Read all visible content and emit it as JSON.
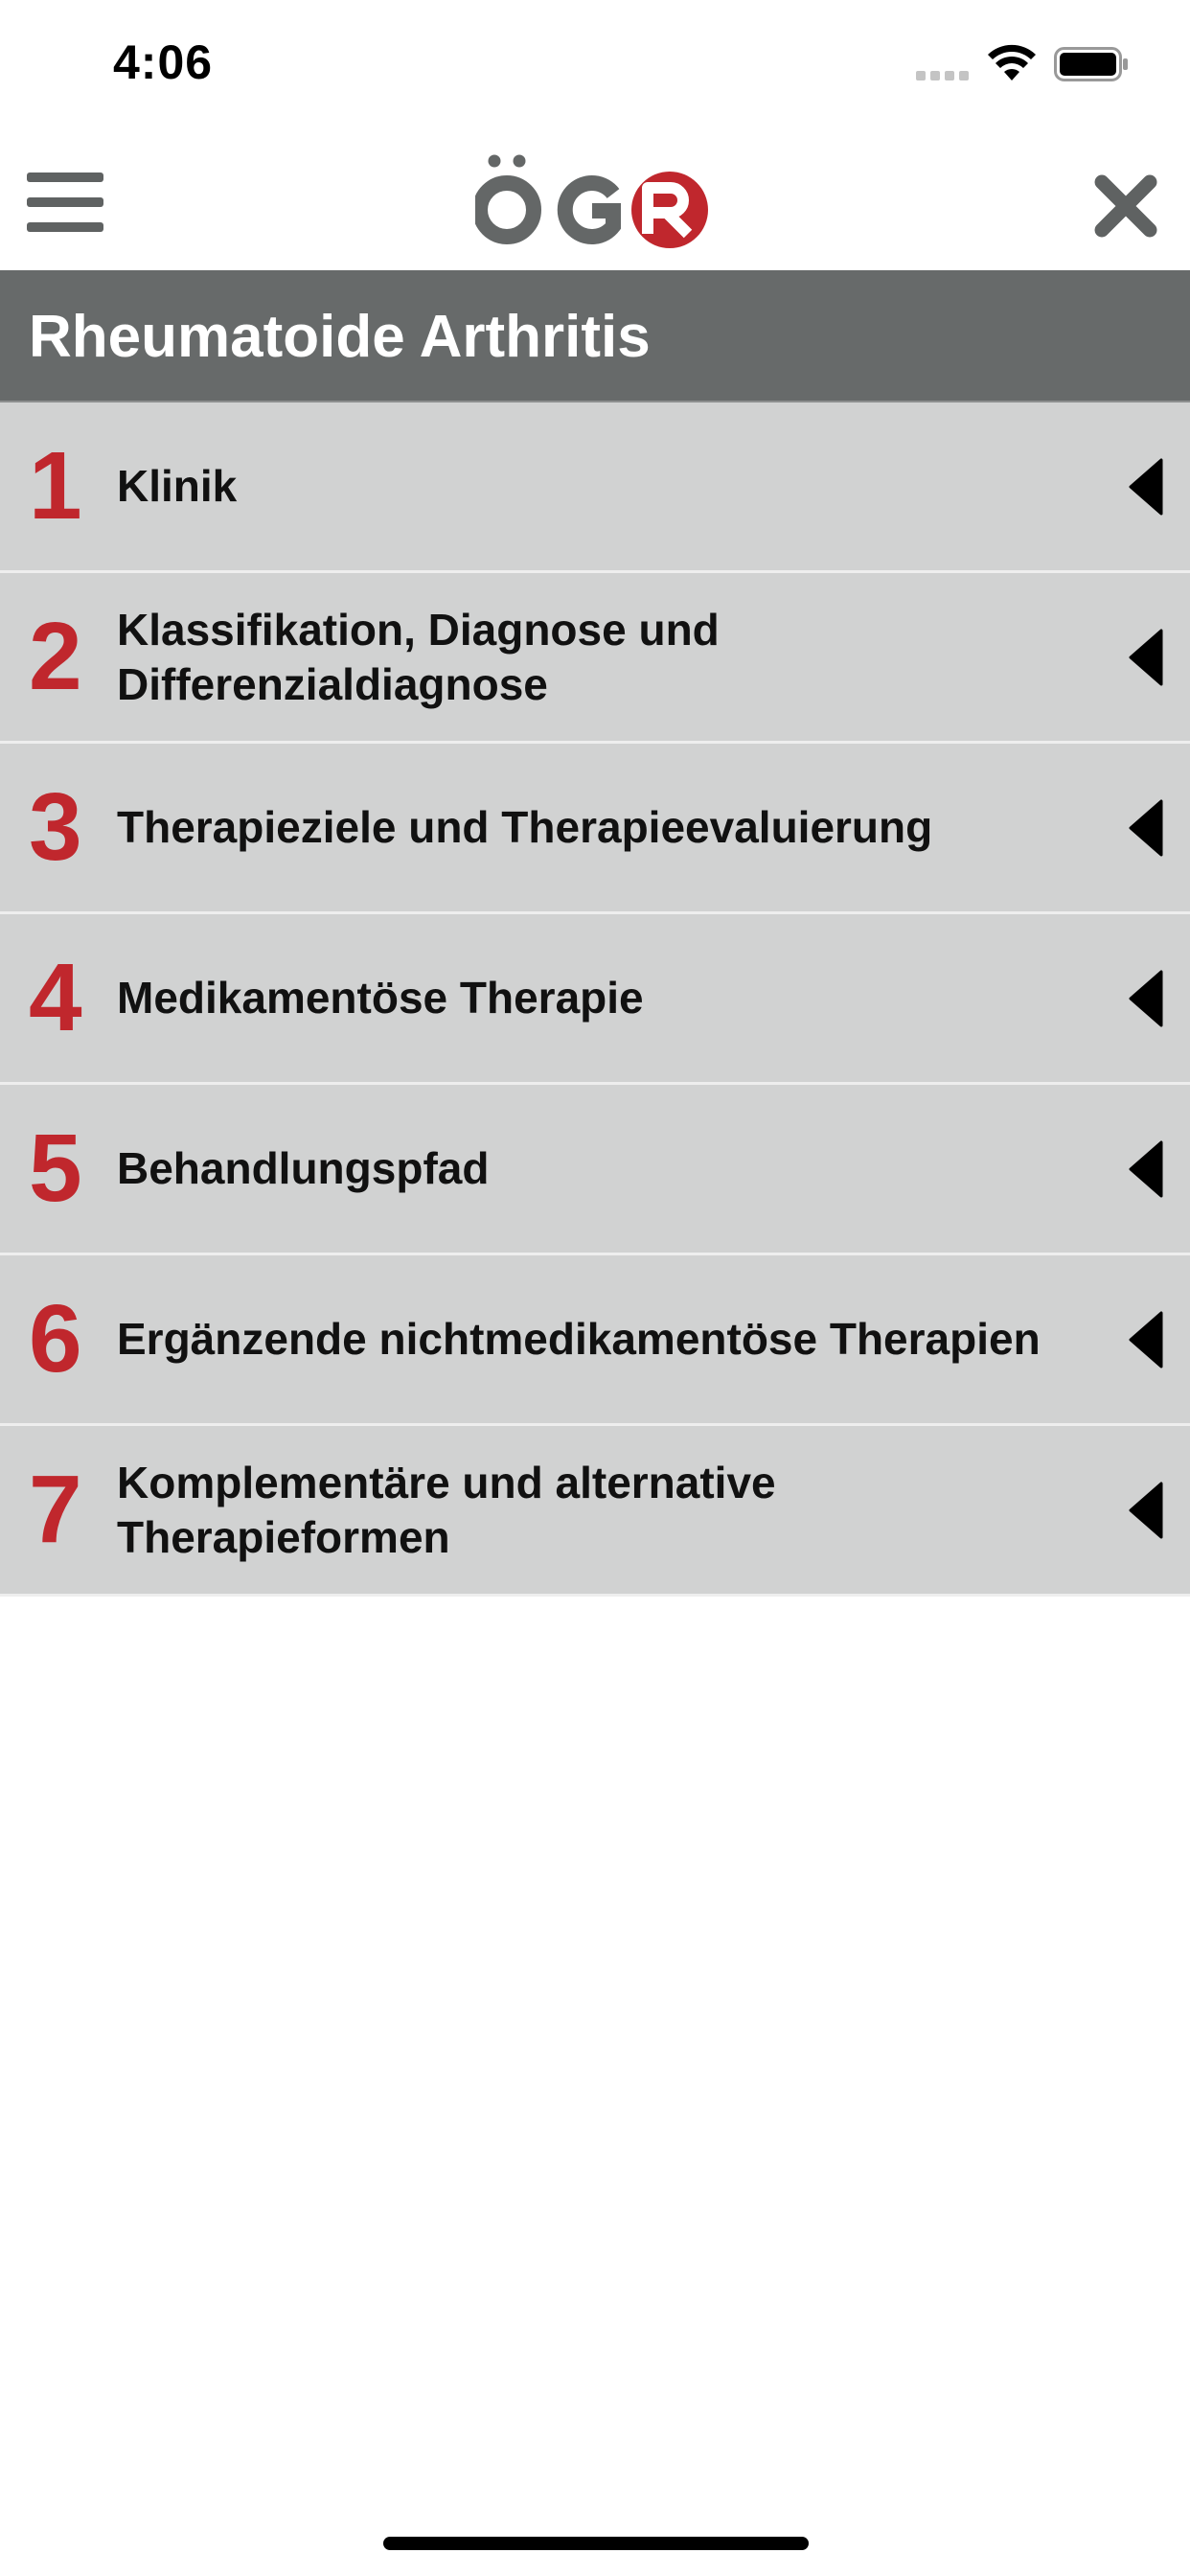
{
  "status_bar": {
    "time": "4:06"
  },
  "header": {
    "logo_text": "ÖGR",
    "brand_color": "#c0272d",
    "logo_gray": "#646767"
  },
  "section": {
    "title": "Rheumatoide Arthritis"
  },
  "chapters": [
    {
      "number": "1",
      "title": "Klinik"
    },
    {
      "number": "2",
      "title": "Klassifikation, Diagnose und Differenzialdiagnose"
    },
    {
      "number": "3",
      "title": "Therapieziele und Therapieevaluierung"
    },
    {
      "number": "4",
      "title": "Medikamentöse Therapie"
    },
    {
      "number": "5",
      "title": "Behandlungspfad"
    },
    {
      "number": "6",
      "title": "Ergänzende nichtmedikamentöse Therapien"
    },
    {
      "number": "7",
      "title": "Komplementäre und alternative Therapieformen"
    }
  ],
  "icons": {
    "menu": "hamburger-menu-icon",
    "close": "close-icon",
    "expand": "caret-left-icon"
  }
}
